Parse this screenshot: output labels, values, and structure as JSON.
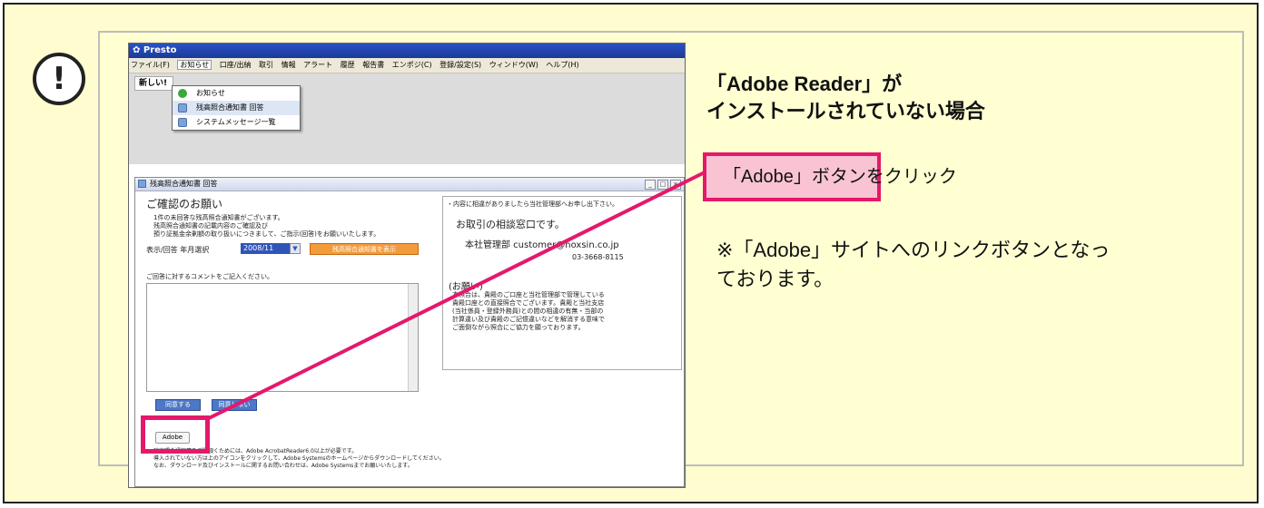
{
  "warning_icon": {
    "glyph": "!"
  },
  "app": {
    "title": "Presto",
    "menus": [
      "ファイル(F)",
      "お知らせ",
      "口座/出納",
      "取引",
      "情報",
      "アラート",
      "履歴",
      "報告書",
      "エンポジ(C)",
      "登録/設定(S)",
      "ウィンドウ(W)",
      "ヘルプ(H)"
    ],
    "new_tab_label": "新しい!",
    "dropdown": [
      {
        "label": "お知らせ",
        "icon": "green-circle-icon"
      },
      {
        "label": "残高照合通知書 回答",
        "icon": "form-icon"
      },
      {
        "label": "システムメッセージ一覧",
        "icon": "form-icon"
      }
    ]
  },
  "dialog": {
    "title": "残高照合通知書 回答",
    "heading": "ご確認のお願い",
    "desc_lines": [
      "1件の未回答な残高照合通知書がございます。",
      "残高照合通知書の記載内容のご確認及び",
      "預り証拠金余剰額の取り扱いにつきまして、ご指示(回答)をお願いいたします。"
    ],
    "select_label": "表示/回答 年月選択",
    "select_value": "2008/11",
    "show_button": "残高照合通知書を表示",
    "comment_label": "ご回答に対するコメントをご記入ください。",
    "agree_button": "同意する",
    "disagree_button": "同意しない",
    "adobe_button": "Adobe",
    "footer_lines": [
      "残高照合通知書をご覧頂くためには、Adobe AcrobatReader6.0以上が必要です。",
      "導入されていない方は上のアイコンをクリックして、Adobe Systemsのホームページからダウンロードしてください。",
      "なお、ダウンロード及びインストールに関するお問い合わせは、Adobe Systemsまでお願いいたします。"
    ],
    "contact": {
      "note": "・内容に相違がありましたら当社管理部へお申し出下さい。",
      "title": "お取引の相談窓口です。",
      "dept": "本社管理部 customer@hoxsin.co.jp",
      "phone": "03-3668-8115",
      "request_title": "(お願い)",
      "request_lines": [
        "本照合は、貴殿のご口座と当社管理部で管理している",
        "貴殿口座との直接照合でございます。貴殿と当社支店",
        "(当社係員・登録外務員)との間の相違の有無・当部の",
        "計算違い及び貴殿のご記憶違いなどを解消する意味で",
        "ご面倒ながら照合にご協力を願っております。"
      ]
    }
  },
  "panel": {
    "title_line1": "「Adobe Reader」が",
    "title_line2": "インストールされていない場合",
    "callout": "「Adobe」ボタンをクリック",
    "note_line1": "※「Adobe」サイトへのリンクボタンとなっ",
    "note_line2": "ております。"
  },
  "colors": {
    "highlight": "#e5186b",
    "callout_fill": "#f9c3d3",
    "panel_bg": "#ffffd2"
  }
}
